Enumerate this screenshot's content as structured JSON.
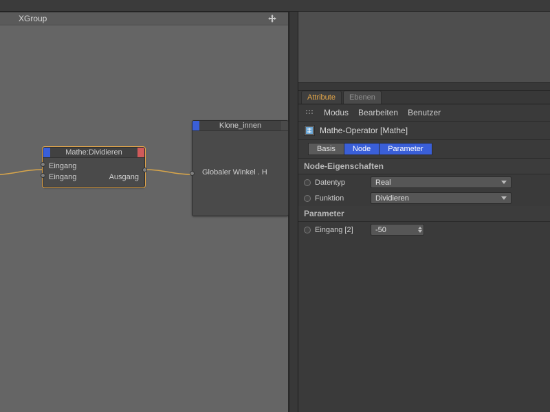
{
  "group": {
    "title": "XGroup",
    "color_chip": "#d05a5a"
  },
  "nodes": {
    "math": {
      "title": "Mathe:Dividieren",
      "inputs": [
        "Eingang",
        "Eingang"
      ],
      "output": "Ausgang"
    },
    "klone": {
      "title": "Klone_innen",
      "input": "Globaler Winkel . H"
    }
  },
  "attribute_manager": {
    "tabs": {
      "attribute": "Attribute",
      "ebenen": "Ebenen",
      "active": "attribute"
    },
    "menu": [
      "Modus",
      "Bearbeiten",
      "Benutzer"
    ],
    "object_name": "Mathe-Operator [Mathe]",
    "subtabs": {
      "basis": "Basis",
      "node": "Node",
      "parameter": "Parameter"
    },
    "sections": {
      "node_props": {
        "title": "Node-Eigenschaften",
        "rows": {
          "datentyp": {
            "label": "Datentyp",
            "value": "Real"
          },
          "funktion": {
            "label": "Funktion",
            "value": "Dividieren"
          }
        }
      },
      "parameter": {
        "title": "Parameter",
        "rows": {
          "eingang2": {
            "label": "Eingang [2]",
            "value": "-50"
          }
        }
      }
    }
  },
  "colors": {
    "accent_orange": "#e7a849",
    "accent_blue": "#3a5fd8"
  }
}
